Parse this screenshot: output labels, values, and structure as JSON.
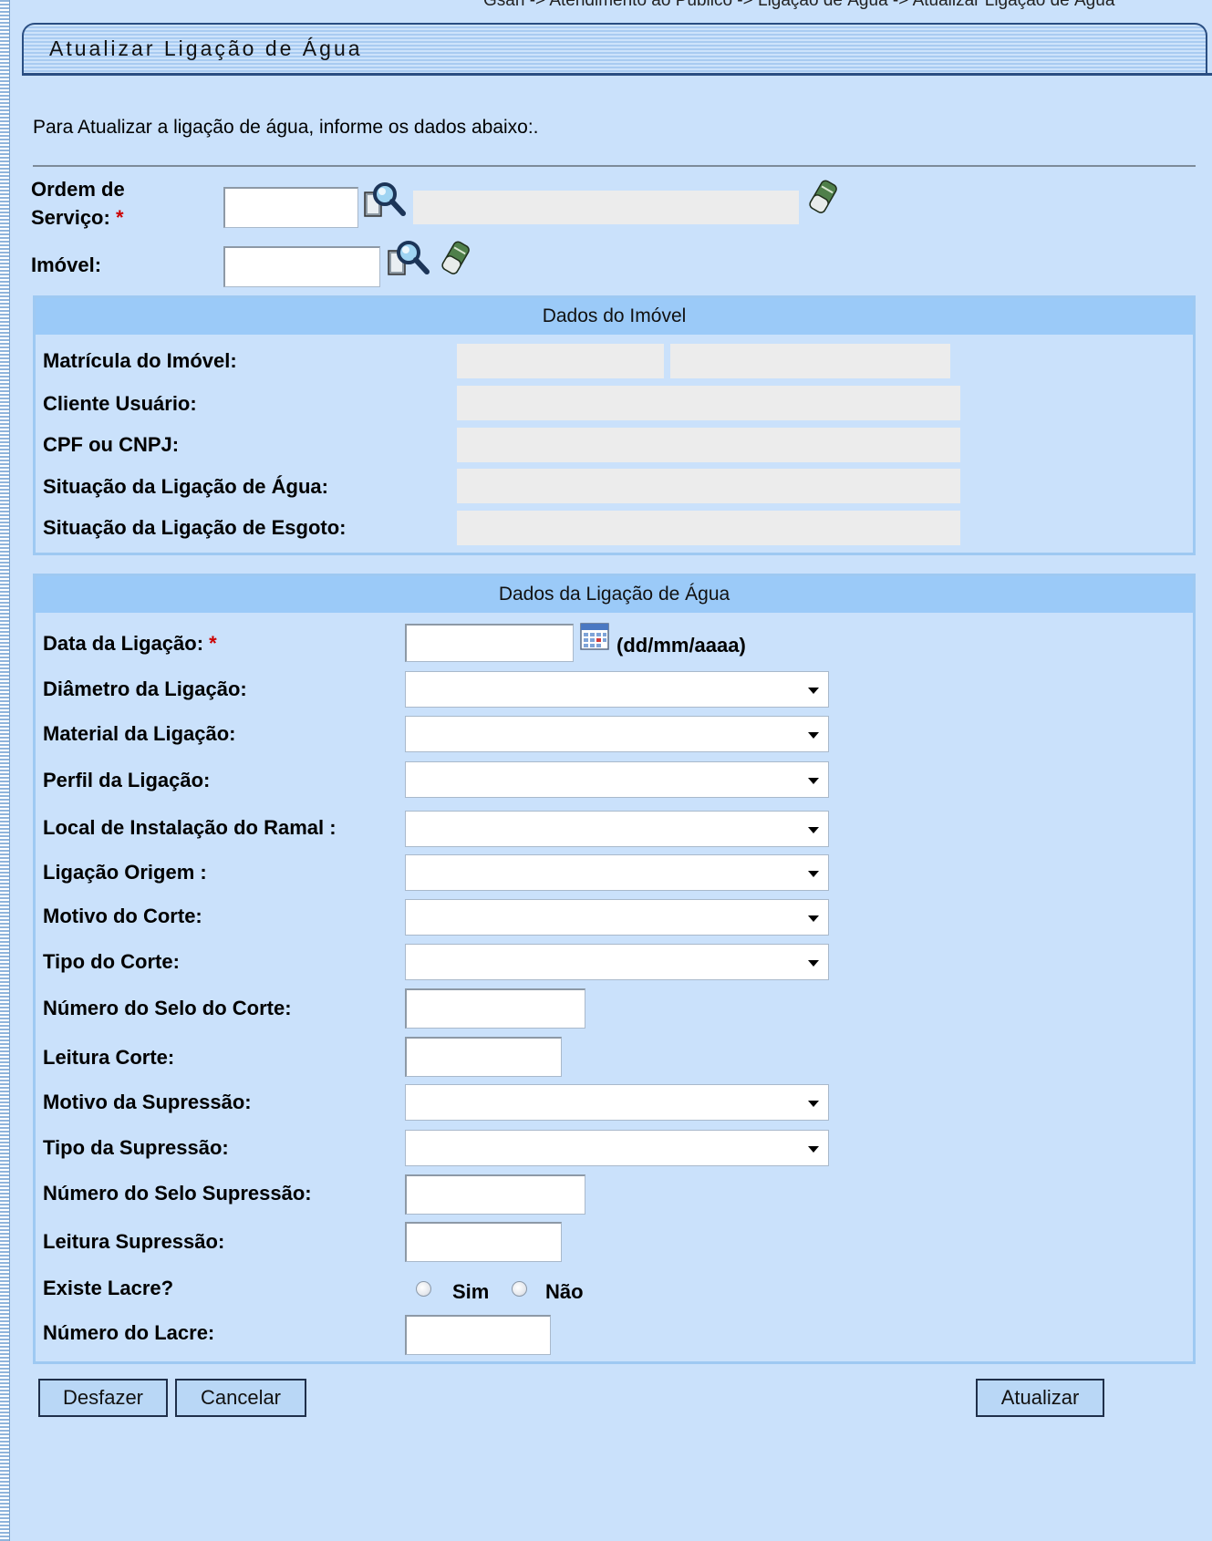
{
  "breadcrumb": "Gsan -> Atendimento ao Público -> Ligação de Água -> Atualizar Ligação de Água",
  "title": "Atualizar Ligação de Água",
  "intro": "Para Atualizar a ligação de água, informe os dados abaixo:.",
  "required_mark": "*",
  "top_fields": {
    "ordem_servico": {
      "label_line1": "Ordem de",
      "label_line2": "Serviço:",
      "value": "",
      "description": ""
    },
    "imovel": {
      "label": "Imóvel:",
      "value": ""
    }
  },
  "dados_imovel": {
    "header": "Dados do Imóvel",
    "fields": [
      {
        "label": "Matrícula do Imóvel:",
        "value": "",
        "value2": ""
      },
      {
        "label": "Cliente Usuário:",
        "value": ""
      },
      {
        "label": "CPF ou CNPJ:",
        "value": ""
      },
      {
        "label": "Situação da Ligação de Água:",
        "value": ""
      },
      {
        "label": "Situação da Ligação de Esgoto:",
        "value": ""
      }
    ]
  },
  "dados_ligacao": {
    "header": "Dados da Ligação de Água",
    "data_ligacao": {
      "label": "Data da Ligação:",
      "value": "",
      "format_hint": "(dd/mm/aaaa)"
    },
    "diametro": {
      "label": "Diâmetro da Ligação:",
      "selected": ""
    },
    "material": {
      "label": "Material da Ligação:",
      "selected": ""
    },
    "perfil": {
      "label": "Perfil da Ligação:",
      "selected": ""
    },
    "local_instalacao": {
      "label": "Local de Instalação do Ramal :",
      "selected": ""
    },
    "ligacao_origem": {
      "label": "Ligação Origem :",
      "selected": ""
    },
    "motivo_corte": {
      "label": "Motivo do Corte:",
      "selected": ""
    },
    "tipo_corte": {
      "label": "Tipo do Corte:",
      "selected": ""
    },
    "numero_selo_corte": {
      "label": "Número do Selo do Corte:",
      "value": ""
    },
    "leitura_corte": {
      "label": "Leitura Corte:",
      "value": ""
    },
    "motivo_supressao": {
      "label": "Motivo da Supressão:",
      "selected": ""
    },
    "tipo_supressao": {
      "label": "Tipo da Supressão:",
      "selected": ""
    },
    "numero_selo_supressao": {
      "label": "Número do Selo Supressão:",
      "value": ""
    },
    "leitura_supressao": {
      "label": "Leitura Supressão:",
      "value": ""
    },
    "existe_lacre": {
      "label": "Existe Lacre?",
      "option_yes": "Sim",
      "option_no": "Não"
    },
    "numero_lacre": {
      "label": "Número do Lacre:",
      "value": ""
    }
  },
  "buttons": {
    "undo": "Desfazer",
    "cancel": "Cancelar",
    "update": "Atualizar"
  },
  "colors": {
    "page_bg": "#cae1fb",
    "section_header": "#9bcaf8",
    "section_border": "#9ec9f2",
    "readonly_field": "#ececec",
    "required": "#cc0000"
  }
}
